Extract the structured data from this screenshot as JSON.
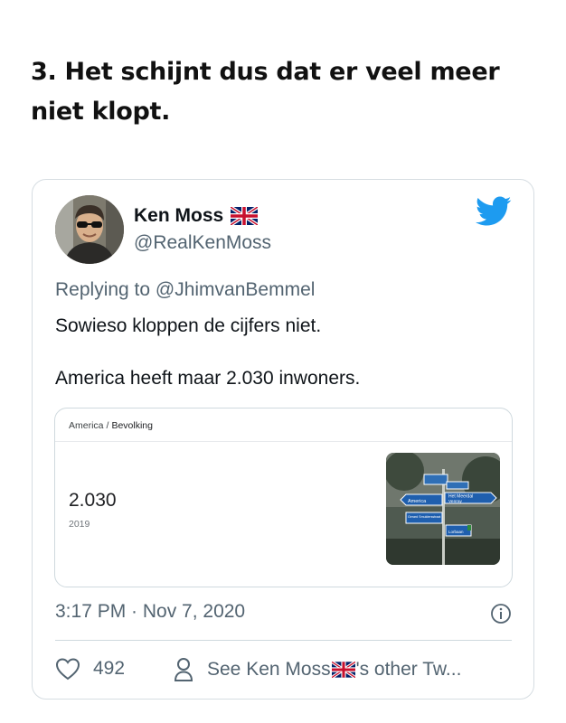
{
  "headline": {
    "line1": "3. Het schijnt dus dat er veel meer",
    "line2": "niet klopt."
  },
  "tweet": {
    "author_name": "Ken Moss",
    "author_handle": "@RealKenMoss",
    "replying_to": "Replying to @JhimvanBemmel",
    "text_line1": "Sowieso kloppen de cijfers niet.",
    "text_line2": "America heeft maar 2.030 inwoners.",
    "link_card": {
      "breadcrumb_place": "America",
      "breadcrumb_sep": "/",
      "breadcrumb_topic": "Bevolking",
      "population": "2.030",
      "year": "2019",
      "sign_labels": [
        "America",
        "Het Meerdal",
        "Venray",
        "Gerard Smuldersstraat",
        "Lorbaan"
      ]
    },
    "timestamp": "3:17 PM · Nov 7, 2020",
    "like_count": "492",
    "profile_link_prefix": "See Ken Moss",
    "profile_link_suffix": "'s other Tw...",
    "colors": {
      "twitter_blue": "#1d9bf0",
      "secondary_text": "#536471"
    },
    "icons": [
      "uk-flag-icon",
      "twitter-bird-icon",
      "info-icon",
      "heart-icon",
      "person-icon"
    ]
  }
}
